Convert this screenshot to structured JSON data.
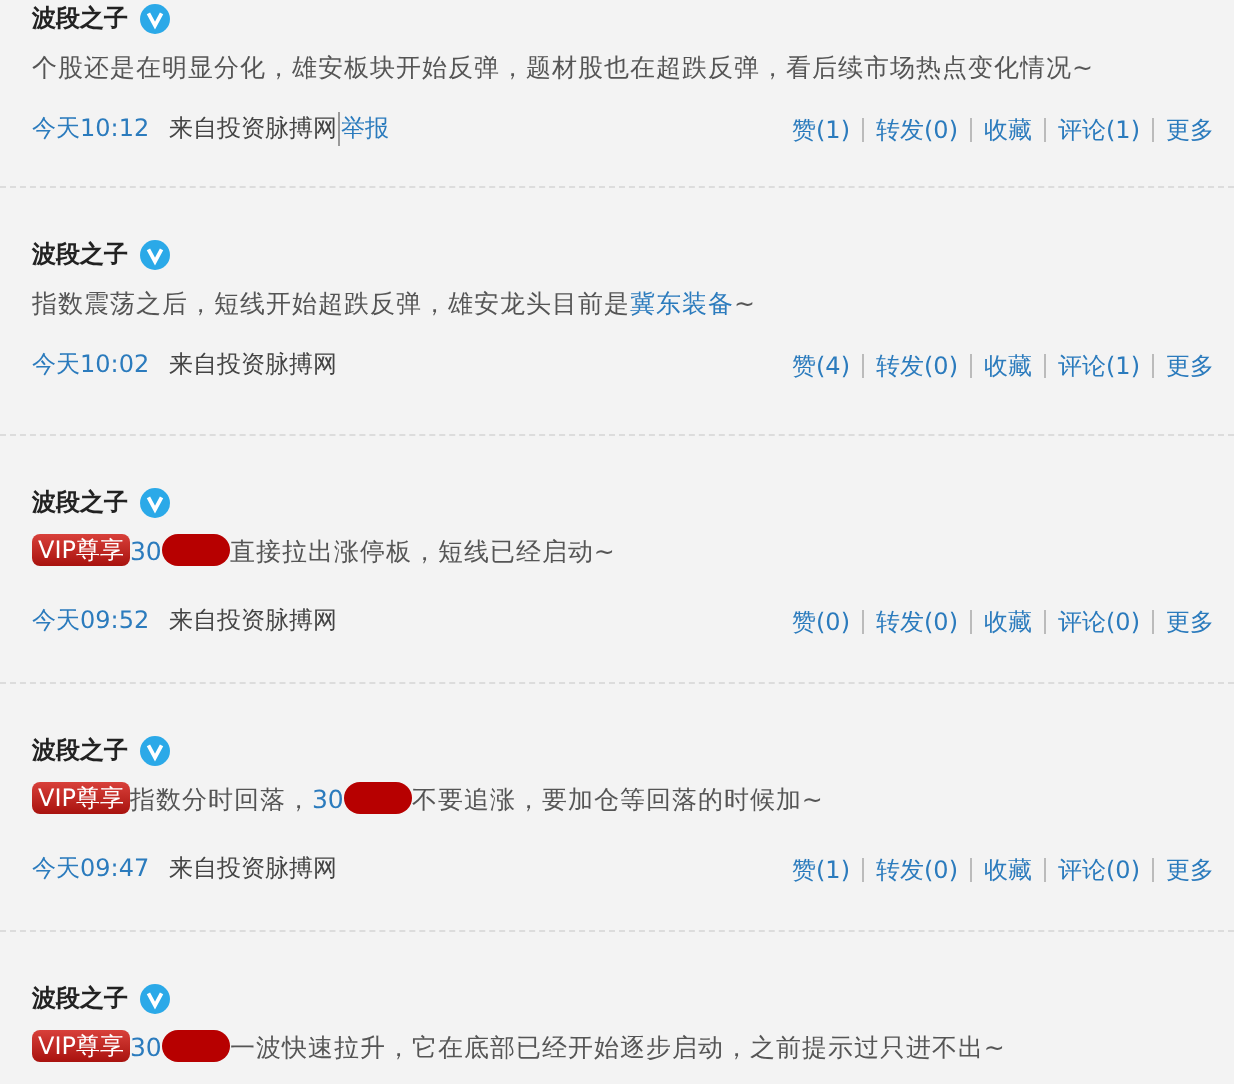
{
  "posts": [
    {
      "author": "波段之子",
      "verified": true,
      "content": [
        {
          "kind": "text",
          "text": "个股还是在明显分化，雄安板块开始反弹，题材股也在超跌反弹，看后续市场热点变化情况~"
        }
      ],
      "time": "今天10:12",
      "source": "来自投资脉搏网",
      "report": "举报",
      "actions": [
        "赞(1)",
        "转发(0)",
        "收藏",
        "评论(1)",
        "更多"
      ]
    },
    {
      "author": "波段之子",
      "verified": true,
      "content": [
        {
          "kind": "text",
          "text": "指数震荡之后，短线开始超跌反弹，雄安龙头目前是"
        },
        {
          "kind": "link",
          "text": "冀东装备"
        },
        {
          "kind": "text",
          "text": "~"
        }
      ],
      "time": "今天10:02",
      "source": "来自投资脉搏网",
      "actions": [
        "赞(4)",
        "转发(0)",
        "收藏",
        "评论(1)",
        "更多"
      ]
    },
    {
      "author": "波段之子",
      "verified": true,
      "vip": "VIP尊享",
      "content": [
        {
          "kind": "link",
          "text": "30"
        },
        {
          "kind": "redacted"
        },
        {
          "kind": "text",
          "text": "直接拉出涨停板，短线已经启动~"
        }
      ],
      "time": "今天09:52",
      "source": "来自投资脉搏网",
      "actions": [
        "赞(0)",
        "转发(0)",
        "收藏",
        "评论(0)",
        "更多"
      ]
    },
    {
      "author": "波段之子",
      "verified": true,
      "vip": "VIP尊享",
      "content": [
        {
          "kind": "text",
          "text": "指数分时回落，"
        },
        {
          "kind": "link",
          "text": "30"
        },
        {
          "kind": "redacted"
        },
        {
          "kind": "text",
          "text": "不要追涨，要加仓等回落的时候加~"
        }
      ],
      "time": "今天09:47",
      "source": "来自投资脉搏网",
      "actions": [
        "赞(1)",
        "转发(0)",
        "收藏",
        "评论(0)",
        "更多"
      ]
    },
    {
      "author": "波段之子",
      "verified": true,
      "vip": "VIP尊享",
      "content": [
        {
          "kind": "link",
          "text": "30"
        },
        {
          "kind": "redacted"
        },
        {
          "kind": "text",
          "text": "一波快速拉升，它在底部已经开始逐步启动，之前提示过只进不出~"
        }
      ]
    }
  ]
}
